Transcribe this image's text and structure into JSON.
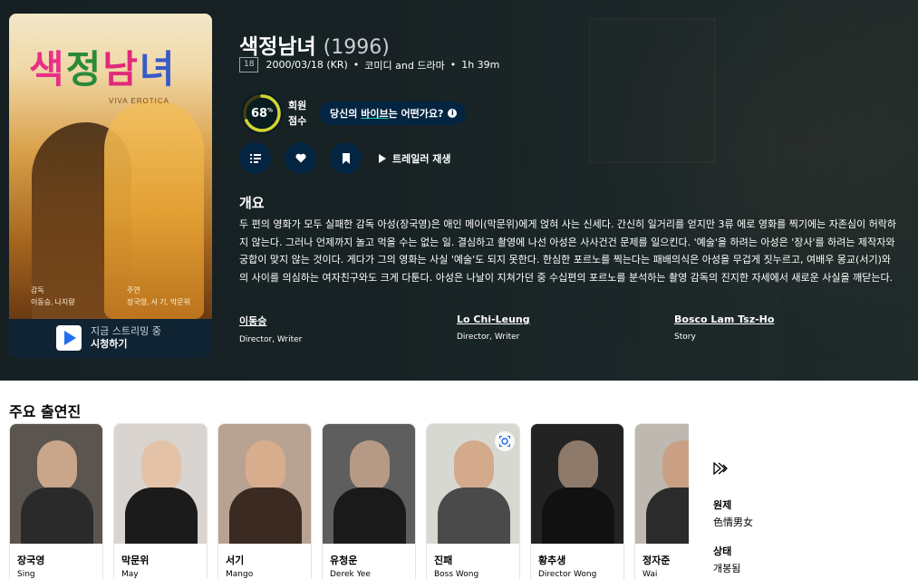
{
  "movie": {
    "title": "색정남녀",
    "year": "(1996)",
    "certification": "18",
    "release": "2000/03/18 (KR)",
    "genres": "코미디 and 드라마",
    "runtime": "1h 39m",
    "score": 68,
    "score_label_1": "회원",
    "score_label_2": "점수",
    "vibe_prefix": "당신의 ",
    "vibe_highlight": "바이브",
    "vibe_suffix": "는 어떤가요?",
    "trailer_label": "트레일러 재생",
    "overview_heading": "개요",
    "overview": "두 편의 영화가 모두 실패한 감독 아성(장국영)은 애인 메이(막문위)에게 얹혀 사는 신세다. 간신히 일거리를 얻지만 3류 에로 영화를 찍기에는 자존심이 허락하지 않는다. 그러나 언제까지 놀고 먹을 수는 없는 일. 결심하고 촬영에 나선 아성은 사사건건 문제를 일으킨다. '예술'을 하려는 아성은 '장사'를 하려는 제작자와 궁합이 맞지 않는 것이다. 게다가 그의 영화는 사실 '예술'도 되지 못한다. 한심한 포르노를 찍는다는 패배의식은 아성을 무겁게 짓누르고, 여배우 몽교(서기)와의 사이를 의심하는 여자친구와도 크게 다툰다. 아성은 나날이 지쳐가던 중 수십편의 포르노를 분석하는 촬영 감독의 진지한 자세에서 새로운 사실을 깨닫는다."
  },
  "poster": {
    "title_chars": [
      "색",
      "정",
      "남",
      "녀"
    ],
    "subtitle": "VIVA EROTICA",
    "director_label": "감독",
    "director_names": "이동승, 나지량",
    "cast_label": "주연",
    "cast_names": "장국영, 서 기, 막문위",
    "stream_line1": "지금 스트리밍 중",
    "stream_line2": "시청하기"
  },
  "crew": [
    {
      "name": "이동승",
      "job": "Director, Writer"
    },
    {
      "name": "Lo Chi-Leung",
      "job": "Director, Writer"
    },
    {
      "name": "Bosco Lam Tsz-Ho",
      "job": "Story"
    }
  ],
  "cast_heading": "주요 출연진",
  "cast": [
    {
      "name": "장국영",
      "role": "Sing"
    },
    {
      "name": "막문위",
      "role": "May"
    },
    {
      "name": "서기",
      "role": "Mango"
    },
    {
      "name": "유청운",
      "role": "Derek Yee"
    },
    {
      "name": "진패",
      "role": "Boss Wong"
    },
    {
      "name": "황추생",
      "role": "Director Wong"
    },
    {
      "name": "정자준",
      "role": "Wai"
    }
  ],
  "facts": {
    "original_title_label": "원제",
    "original_title": "色情男女",
    "status_label": "상태",
    "status": "개봉됨"
  },
  "colors": {
    "score_ring": "#d2d531",
    "score_track": "#423d0f",
    "accent": "#1ed5a9",
    "button_bg": "#032541"
  },
  "icons": {
    "list": "list-icon",
    "favorite": "heart-icon",
    "watchlist": "bookmark-icon",
    "play": "play-icon",
    "info": "info-icon",
    "zoom": "zoom-icon",
    "more": "arrow-right-icon"
  }
}
